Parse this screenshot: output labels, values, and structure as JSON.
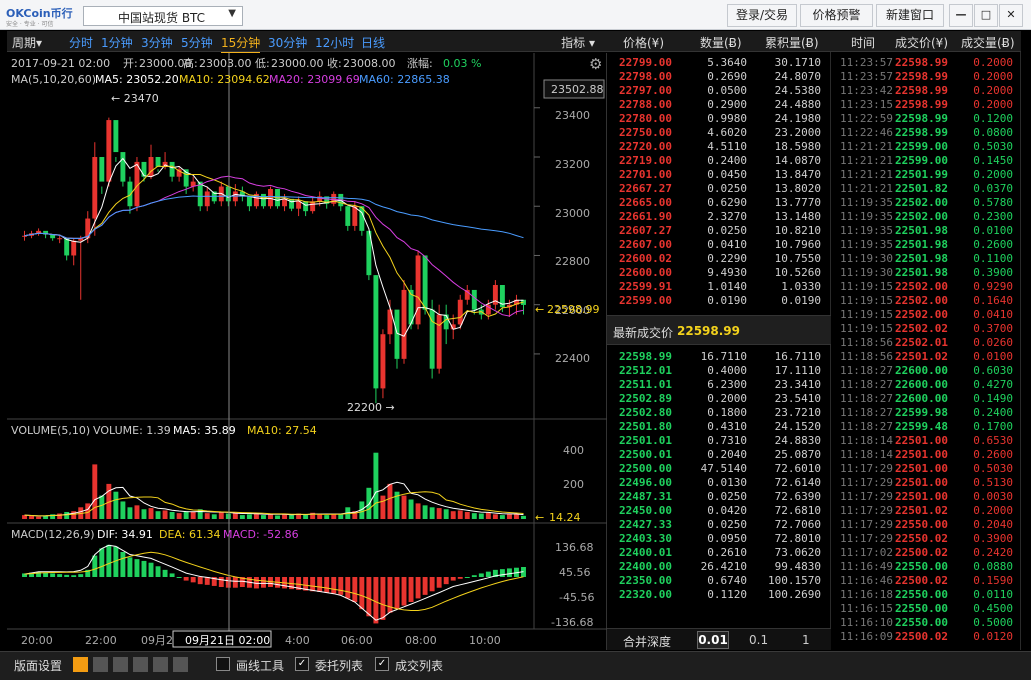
{
  "titlebar": {
    "logo_text": "OKCoin币行",
    "logo_sub": "安全 · 专业 · 可信",
    "market": "中国站现货 BTC",
    "login_label": "登录/交易",
    "alert_label": "价格预警",
    "new_window_label": "新建窗口",
    "min_label": "—",
    "max_label": "□",
    "close_label": "✕"
  },
  "chartbar": {
    "period_label": "周期▾",
    "timeframes": [
      "分时",
      "1分钟",
      "3分钟",
      "5分钟",
      "15分钟",
      "30分钟",
      "12小时",
      "日线"
    ],
    "active_timeframe": "15分钟",
    "indicator_label": "指标 ▾"
  },
  "ohlc_info": {
    "date": "2017-09-21 02:00",
    "open_label": "开:",
    "open": "23000.00",
    "high_label": "高:",
    "high": "23003.00",
    "low_label": "低:",
    "low": "23000.00",
    "close_label": "收:",
    "close": "23008.00",
    "change_label": "涨幅:",
    "change": "0.03 %"
  },
  "ma_info": {
    "title": "MA(5,10,20,60)",
    "ma5": "MA5: 23052.20",
    "ma10": "MA10: 23094.62",
    "ma20": "MA20: 23099.69",
    "ma60": "MA60: 22865.38"
  },
  "volume_info": {
    "title": "VOLUME(5,10)",
    "volume": "VOLUME: 1.39",
    "ma5": "MA5: 35.89",
    "ma10": "MA10: 27.54"
  },
  "macd_info": {
    "title": "MACD(12,26,9)",
    "dif": "DIF: 34.91",
    "dea": "DEA: 61.34",
    "macd": "MACD: -52.86"
  },
  "price_axis": [
    "23400",
    "23200",
    "23000",
    "22800",
    "22600",
    "22400"
  ],
  "price_axis_top_label": "23502.88",
  "current_price_marker": "22598.99",
  "high_marker": "← 23470",
  "low_marker": "22200 →",
  "volume_axis": [
    "400",
    "200"
  ],
  "volume_marker": "14.24",
  "macd_axis": [
    "136.68",
    "45.56",
    "-45.56",
    "-136.68"
  ],
  "time_axis": [
    "20:00",
    "22:00",
    "09月21",
    "4:00",
    "06:00",
    "08:00",
    "10:00"
  ],
  "crosshair_time": "09月21日 02:00",
  "colors": {
    "up": "#e8342f",
    "down": "#1fd15e",
    "ma5": "#ffffff",
    "ma10": "#f3d21c",
    "ma20": "#d63ee0",
    "ma60": "#4a9cff"
  },
  "chart_data": {
    "type": "candlestick",
    "candles_estimated": [
      [
        22880,
        22900,
        22860,
        22880
      ],
      [
        22880,
        22900,
        22870,
        22890
      ],
      [
        22890,
        22910,
        22880,
        22900
      ],
      [
        22900,
        22890,
        22870,
        22885
      ],
      [
        22885,
        22870,
        22860,
        22870
      ],
      [
        22870,
        22880,
        22850,
        22870
      ],
      [
        22870,
        22860,
        22780,
        22800
      ],
      [
        22800,
        22870,
        22760,
        22860
      ],
      [
        22860,
        22880,
        22620,
        22870
      ],
      [
        22870,
        22980,
        22850,
        22950
      ],
      [
        22950,
        23260,
        22880,
        23200
      ],
      [
        23200,
        23080,
        23050,
        23100
      ],
      [
        23100,
        23360,
        23080,
        23350
      ],
      [
        23350,
        23200,
        23180,
        23220
      ],
      [
        23220,
        23120,
        23080,
        23100
      ],
      [
        23100,
        23120,
        22970,
        23000
      ],
      [
        23000,
        23200,
        22980,
        23180
      ],
      [
        23180,
        23150,
        23100,
        23120
      ],
      [
        23120,
        23250,
        23110,
        23200
      ],
      [
        23200,
        23150,
        23140,
        23160
      ],
      [
        23160,
        23220,
        23150,
        23180
      ],
      [
        23180,
        23150,
        23100,
        23120
      ],
      [
        23120,
        23160,
        23100,
        23150
      ],
      [
        23150,
        23100,
        23050,
        23080
      ],
      [
        23080,
        23120,
        23060,
        23100
      ],
      [
        23100,
        23050,
        22980,
        23000
      ],
      [
        23000,
        23080,
        22980,
        23060
      ],
      [
        23060,
        23040,
        23010,
        23020
      ],
      [
        23020,
        23100,
        23000,
        23080
      ],
      [
        23080,
        23050,
        23000,
        23020
      ],
      [
        23020,
        23090,
        23000,
        23060
      ],
      [
        23060,
        23080,
        23020,
        23040
      ],
      [
        23040,
        23020,
        22980,
        23000
      ],
      [
        23000,
        23060,
        22990,
        23050
      ],
      [
        23050,
        23020,
        22990,
        23000
      ],
      [
        23000,
        23080,
        22990,
        23070
      ],
      [
        23070,
        23020,
        22990,
        23000
      ],
      [
        23000,
        23050,
        22980,
        23030
      ],
      [
        23030,
        23010,
        22980,
        22990
      ],
      [
        22990,
        23040,
        22960,
        23020
      ],
      [
        23020,
        23000,
        22960,
        22980
      ],
      [
        22980,
        23040,
        22970,
        23020
      ],
      [
        23020,
        23060,
        23000,
        23040
      ],
      [
        23040,
        23030,
        22990,
        23010
      ],
      [
        23010,
        23060,
        23000,
        23050
      ],
      [
        23050,
        23020,
        22980,
        23000
      ],
      [
        23000,
        23000,
        22900,
        22920
      ],
      [
        22920,
        23020,
        22900,
        23000
      ],
      [
        23000,
        23000,
        22880,
        22900
      ],
      [
        22900,
        22900,
        22700,
        22720
      ],
      [
        22720,
        22720,
        22200,
        22260
      ],
      [
        22260,
        22500,
        22220,
        22480
      ],
      [
        22480,
        22620,
        22440,
        22580
      ],
      [
        22580,
        22560,
        22340,
        22380
      ],
      [
        22380,
        22700,
        22360,
        22660
      ],
      [
        22660,
        22680,
        22500,
        22520
      ],
      [
        22520,
        22820,
        22500,
        22800
      ],
      [
        22800,
        22780,
        22560,
        22580
      ],
      [
        22580,
        22620,
        22300,
        22340
      ],
      [
        22340,
        22600,
        22320,
        22560
      ],
      [
        22560,
        22600,
        22440,
        22500
      ],
      [
        22500,
        22560,
        22460,
        22520
      ],
      [
        22520,
        22640,
        22500,
        22620
      ],
      [
        22620,
        22680,
        22600,
        22660
      ],
      [
        22660,
        22620,
        22560,
        22580
      ],
      [
        22580,
        22600,
        22540,
        22560
      ],
      [
        22560,
        22620,
        22540,
        22600
      ],
      [
        22600,
        22700,
        22580,
        22680
      ],
      [
        22680,
        22640,
        22570,
        22590
      ],
      [
        22590,
        22620,
        22550,
        22600
      ],
      [
        22600,
        22640,
        22560,
        22620
      ],
      [
        22620,
        22600,
        22560,
        22599
      ]
    ],
    "volume_estimated": [
      10,
      8,
      6,
      9,
      12,
      14,
      18,
      20,
      30,
      40,
      140,
      60,
      90,
      70,
      45,
      30,
      35,
      25,
      28,
      20,
      22,
      18,
      15,
      20,
      18,
      25,
      15,
      12,
      18,
      14,
      16,
      10,
      12,
      15,
      10,
      14,
      9,
      12,
      10,
      14,
      12,
      16,
      12,
      10,
      14,
      12,
      30,
      20,
      45,
      80,
      170,
      60,
      90,
      70,
      60,
      50,
      40,
      35,
      30,
      28,
      25,
      20,
      22,
      18,
      15,
      14,
      16,
      12,
      10,
      14,
      12,
      8
    ],
    "macd_hist_estimated": [
      10,
      12,
      14,
      12,
      10,
      8,
      6,
      5,
      8,
      20,
      60,
      80,
      90,
      85,
      70,
      55,
      50,
      45,
      40,
      30,
      20,
      10,
      0,
      -10,
      -15,
      -20,
      -22,
      -25,
      -28,
      -30,
      -30,
      -28,
      -30,
      -32,
      -30,
      -28,
      -30,
      -32,
      -34,
      -36,
      -38,
      -40,
      -42,
      -44,
      -46,
      -50,
      -60,
      -70,
      -90,
      -110,
      -130,
      -120,
      -100,
      -90,
      -80,
      -70,
      -60,
      -50,
      -40,
      -30,
      -20,
      -10,
      -5,
      0,
      5,
      10,
      15,
      20,
      22,
      24,
      26,
      28
    ]
  },
  "book": {
    "headers": [
      "价格(¥)",
      "数量(Ƀ)",
      "累积量(Ƀ)"
    ],
    "asks": [
      [
        "22799.00",
        "5.3640",
        "30.1710"
      ],
      [
        "22798.00",
        "0.2690",
        "24.8070"
      ],
      [
        "22797.00",
        "0.0500",
        "24.5380"
      ],
      [
        "22788.00",
        "0.2900",
        "24.4880"
      ],
      [
        "22780.00",
        "0.9980",
        "24.1980"
      ],
      [
        "22750.00",
        "4.6020",
        "23.2000"
      ],
      [
        "22720.00",
        "4.5110",
        "18.5980"
      ],
      [
        "22719.00",
        "0.2400",
        "14.0870"
      ],
      [
        "22701.00",
        "0.0450",
        "13.8470"
      ],
      [
        "22667.27",
        "0.0250",
        "13.8020"
      ],
      [
        "22665.00",
        "0.6290",
        "13.7770"
      ],
      [
        "22661.90",
        "2.3270",
        "13.1480"
      ],
      [
        "22607.27",
        "0.0250",
        "10.8210"
      ],
      [
        "22607.00",
        "0.0410",
        "10.7960"
      ],
      [
        "22600.02",
        "0.2290",
        "10.7550"
      ],
      [
        "22600.00",
        "9.4930",
        "10.5260"
      ],
      [
        "22599.91",
        "1.0140",
        "1.0330"
      ],
      [
        "22599.00",
        "0.0190",
        "0.0190"
      ]
    ],
    "last_label": "最新成交价",
    "last_price": "22598.99",
    "bids": [
      [
        "22598.99",
        "16.7110",
        "16.7110"
      ],
      [
        "22512.01",
        "0.4000",
        "17.1110"
      ],
      [
        "22511.01",
        "6.2300",
        "23.3410"
      ],
      [
        "22502.89",
        "0.2000",
        "23.5410"
      ],
      [
        "22502.80",
        "0.1800",
        "23.7210"
      ],
      [
        "22501.80",
        "0.4310",
        "24.1520"
      ],
      [
        "22501.01",
        "0.7310",
        "24.8830"
      ],
      [
        "22500.01",
        "0.2040",
        "25.0870"
      ],
      [
        "22500.00",
        "47.5140",
        "72.6010"
      ],
      [
        "22496.00",
        "0.0130",
        "72.6140"
      ],
      [
        "22487.31",
        "0.0250",
        "72.6390"
      ],
      [
        "22450.00",
        "0.0420",
        "72.6810"
      ],
      [
        "22427.33",
        "0.0250",
        "72.7060"
      ],
      [
        "22403.30",
        "0.0950",
        "72.8010"
      ],
      [
        "22400.01",
        "0.2610",
        "73.0620"
      ],
      [
        "22400.00",
        "26.4210",
        "99.4830"
      ],
      [
        "22350.00",
        "0.6740",
        "100.1570"
      ],
      [
        "22320.00",
        "0.1120",
        "100.2690"
      ]
    ],
    "depth_label": "合并深度",
    "depth_options": [
      "0.01",
      "0.1",
      "1"
    ],
    "depth_selected": "0.01"
  },
  "trades": {
    "headers": [
      "时间",
      "成交价(¥)",
      "成交量(Ƀ)"
    ],
    "rows": [
      [
        "11:23:57",
        "22598.99",
        "0.2000",
        "up"
      ],
      [
        "11:23:57",
        "22598.99",
        "0.2000",
        "up"
      ],
      [
        "11:23:42",
        "22598.99",
        "0.2000",
        "up"
      ],
      [
        "11:23:15",
        "22598.99",
        "0.2000",
        "up"
      ],
      [
        "11:22:59",
        "22598.99",
        "0.1200",
        "down"
      ],
      [
        "11:22:46",
        "22598.99",
        "0.0800",
        "down"
      ],
      [
        "11:21:21",
        "22599.00",
        "0.5030",
        "down"
      ],
      [
        "11:21:21",
        "22599.00",
        "0.1450",
        "down"
      ],
      [
        "11:21:21",
        "22501.99",
        "0.2000",
        "down"
      ],
      [
        "11:21:21",
        "22501.82",
        "0.0370",
        "down"
      ],
      [
        "11:19:35",
        "22502.00",
        "0.5780",
        "down"
      ],
      [
        "11:19:35",
        "22502.00",
        "0.2300",
        "down"
      ],
      [
        "11:19:35",
        "22501.98",
        "0.0100",
        "down"
      ],
      [
        "11:19:35",
        "22501.98",
        "0.2600",
        "down"
      ],
      [
        "11:19:30",
        "22501.98",
        "0.1100",
        "down"
      ],
      [
        "11:19:30",
        "22501.98",
        "0.3900",
        "down"
      ],
      [
        "11:19:15",
        "22502.00",
        "0.9290",
        "up"
      ],
      [
        "11:19:15",
        "22502.00",
        "0.1640",
        "up"
      ],
      [
        "11:19:15",
        "22502.00",
        "0.0410",
        "up"
      ],
      [
        "11:19:15",
        "22502.02",
        "0.3700",
        "up"
      ],
      [
        "11:18:56",
        "22502.01",
        "0.0260",
        "up"
      ],
      [
        "11:18:56",
        "22501.02",
        "0.0100",
        "up"
      ],
      [
        "11:18:27",
        "22600.00",
        "0.6030",
        "down"
      ],
      [
        "11:18:27",
        "22600.00",
        "0.4270",
        "down"
      ],
      [
        "11:18:27",
        "22600.00",
        "0.1490",
        "down"
      ],
      [
        "11:18:27",
        "22599.98",
        "0.2400",
        "down"
      ],
      [
        "11:18:27",
        "22599.48",
        "0.1700",
        "down"
      ],
      [
        "11:18:14",
        "22501.00",
        "0.6530",
        "up"
      ],
      [
        "11:18:14",
        "22501.00",
        "0.2600",
        "up"
      ],
      [
        "11:17:29",
        "22501.00",
        "0.5030",
        "up"
      ],
      [
        "11:17:29",
        "22501.00",
        "0.5130",
        "up"
      ],
      [
        "11:17:29",
        "22501.00",
        "0.0030",
        "up"
      ],
      [
        "11:17:29",
        "22501.02",
        "0.2000",
        "up"
      ],
      [
        "11:17:29",
        "22550.00",
        "0.2040",
        "up"
      ],
      [
        "11:17:29",
        "22550.02",
        "0.3900",
        "up"
      ],
      [
        "11:17:02",
        "22500.02",
        "0.2420",
        "up"
      ],
      [
        "11:16:49",
        "22550.00",
        "0.0880",
        "down"
      ],
      [
        "11:16:46",
        "22500.02",
        "0.1590",
        "up"
      ],
      [
        "11:16:18",
        "22550.00",
        "0.0110",
        "down"
      ],
      [
        "11:16:15",
        "22550.00",
        "0.4500",
        "down"
      ],
      [
        "11:16:10",
        "22550.00",
        "0.5000",
        "down"
      ],
      [
        "11:16:09",
        "22500.02",
        "0.0120",
        "up"
      ]
    ]
  },
  "bottombar": {
    "layout_label": "版面设置",
    "draw_tools_label": "画线工具",
    "orders_label": "委托列表",
    "trades_label": "成交列表",
    "checkmark": "✓"
  }
}
